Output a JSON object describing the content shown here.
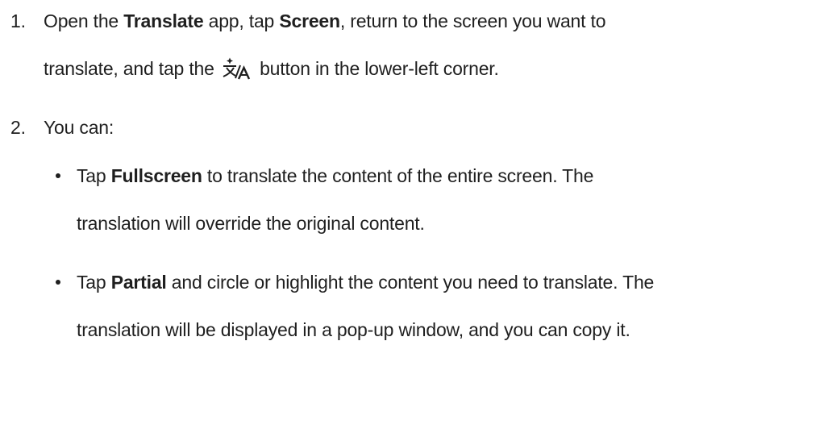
{
  "steps": [
    {
      "number": "1.",
      "line1": {
        "a": "Open the ",
        "b": "Translate",
        "c": " app, tap ",
        "d": "Screen",
        "e": ", return to the screen you want to"
      },
      "line2": {
        "a": "translate, and tap the ",
        "icon": "translate-icon",
        "b": " button in the lower-left corner."
      }
    },
    {
      "number": "2.",
      "text": "You can:",
      "bullets": [
        {
          "line1": {
            "a": "Tap ",
            "b": "Fullscreen",
            "c": " to translate the content of the entire screen. The"
          },
          "line2": "translation will override the original content."
        },
        {
          "line1": {
            "a": "Tap ",
            "b": "Partial",
            "c": " and circle or highlight the content you need to translate. The"
          },
          "line2": "translation will be displayed in a pop-up window, and you can copy it."
        }
      ]
    }
  ]
}
